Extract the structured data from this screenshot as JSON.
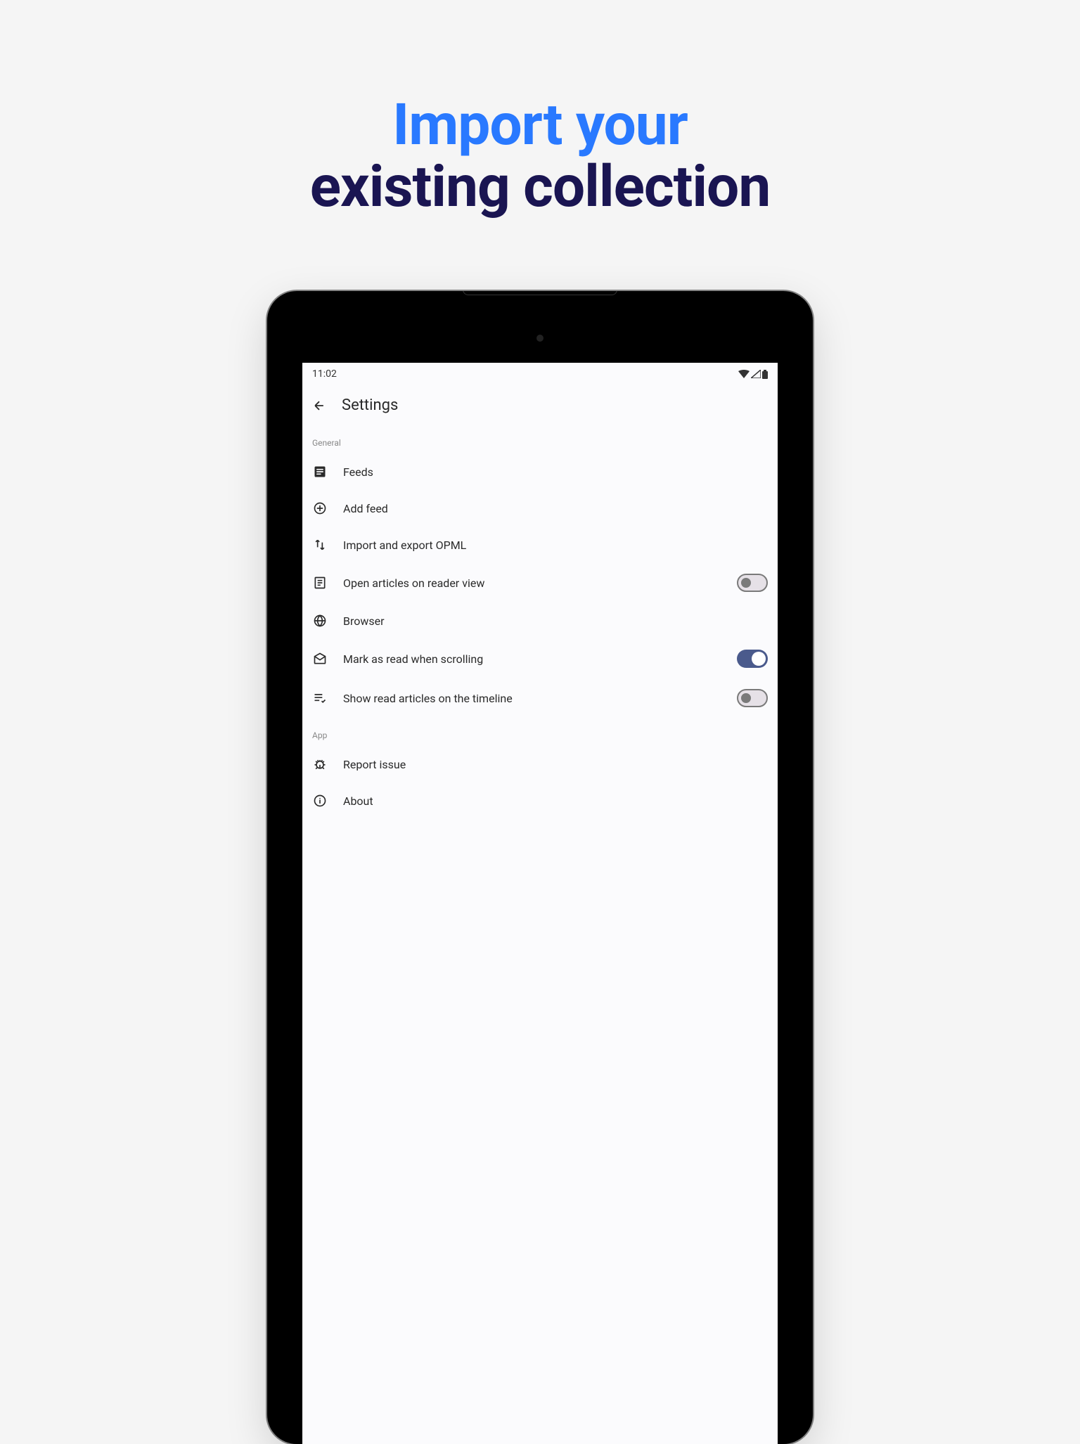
{
  "hero": {
    "line1": "Import your",
    "line2": "existing collection"
  },
  "statusbar": {
    "time": "11:02"
  },
  "appbar": {
    "title": "Settings"
  },
  "sections": {
    "general": {
      "label": "General",
      "items": {
        "feeds": "Feeds",
        "add_feed": "Add feed",
        "import_export": "Import and export OPML",
        "reader_view": "Open articles on reader view",
        "browser": "Browser",
        "mark_read": "Mark as read when scrolling",
        "show_read": "Show read articles on the timeline"
      },
      "toggles": {
        "reader_view": false,
        "mark_read": true,
        "show_read": false
      }
    },
    "app": {
      "label": "App",
      "items": {
        "report_issue": "Report issue",
        "about": "About"
      }
    }
  }
}
